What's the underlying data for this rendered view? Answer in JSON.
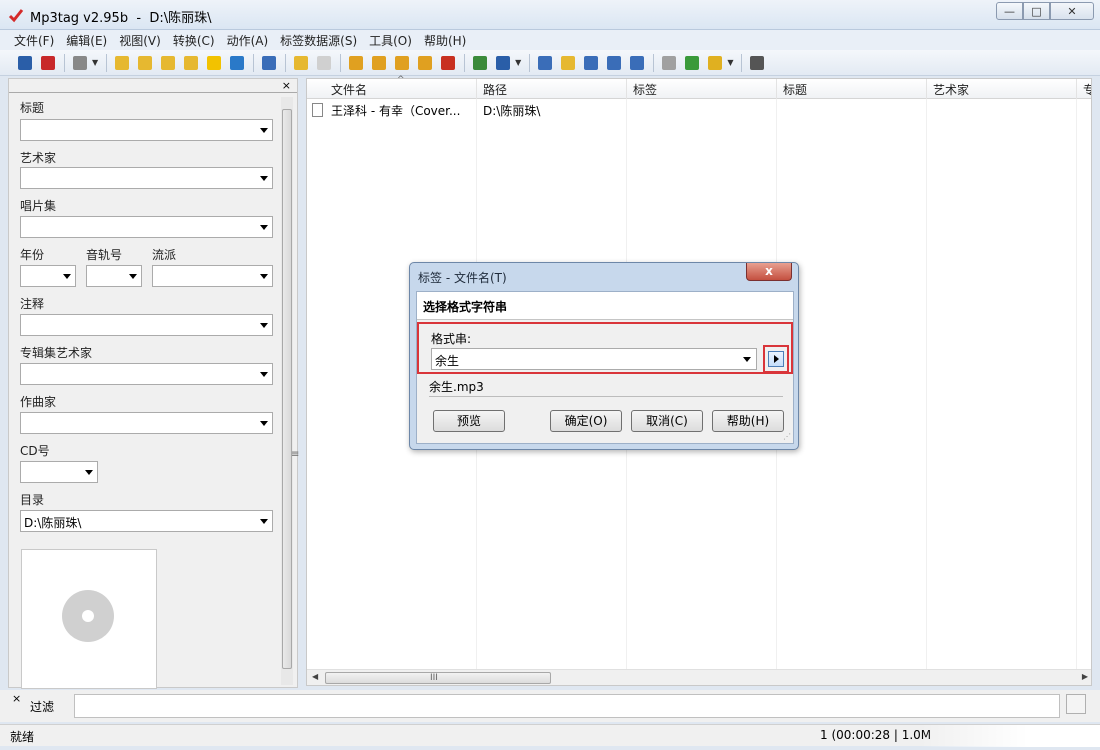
{
  "window": {
    "title": "Mp3tag v2.95b",
    "path": "D:\\陈丽珠\\",
    "minimize": "—",
    "maximize": "□",
    "close": "✕"
  },
  "menu": [
    "文件(F)",
    "编辑(E)",
    "视图(V)",
    "转换(C)",
    "动作(A)",
    "标签数据源(S)",
    "工具(O)",
    "帮助(H)"
  ],
  "toolbar": {
    "icons": [
      {
        "name": "save-icon",
        "color": "#2a5ea8"
      },
      {
        "name": "delete-icon",
        "color": "#c8282a"
      },
      {
        "name": "undo-icon",
        "color": "#888888"
      },
      {
        "name": "change-directory-icon",
        "color": "#e6b830"
      },
      {
        "name": "add-directory-icon",
        "color": "#e6b830"
      },
      {
        "name": "refresh-icon",
        "color": "#e6b830"
      },
      {
        "name": "open-folder-icon",
        "color": "#e6b830"
      },
      {
        "name": "favorites-icon",
        "color": "#f2c200"
      },
      {
        "name": "reload-icon",
        "color": "#2a79c8"
      },
      {
        "name": "list-icon",
        "color": "#3a6db8"
      },
      {
        "name": "copy-icon",
        "color": "#e6b830"
      },
      {
        "name": "paste-icon",
        "color": "#d0d0d0"
      },
      {
        "name": "tag-filename-icon",
        "color": "#e0a020"
      },
      {
        "name": "filename-tag-icon",
        "color": "#e0a020"
      },
      {
        "name": "filename-filename-icon",
        "color": "#e0a020"
      },
      {
        "name": "text-tag-icon",
        "color": "#e0a020"
      },
      {
        "name": "tag-tag-icon",
        "color": "#c83020"
      },
      {
        "name": "autonumber-icon",
        "color": "#3a8a3a"
      },
      {
        "name": "case-convert-icon",
        "color": "#2a5ea8"
      },
      {
        "name": "edit-icon",
        "color": "#3a6db8"
      },
      {
        "name": "export-icon",
        "color": "#e6b830"
      },
      {
        "name": "playlist-icon",
        "color": "#3a6db8"
      },
      {
        "name": "import-icon",
        "color": "#3a6db8"
      },
      {
        "name": "number-icon",
        "color": "#3a6db8"
      },
      {
        "name": "discogs-icon",
        "color": "#a0a0a0"
      },
      {
        "name": "freedb-icon",
        "color": "#3a9a3a"
      },
      {
        "name": "musicbrainz-icon",
        "color": "#e0b020"
      },
      {
        "name": "options-icon",
        "color": "#555555"
      }
    ]
  },
  "tag_panel": {
    "close": "×",
    "title_label": "标题",
    "artist_label": "艺术家",
    "album_label": "唱片集",
    "year_label": "年份",
    "track_label": "音轨号",
    "genre_label": "流派",
    "comment_label": "注释",
    "album_artist_label": "专辑集艺术家",
    "composer_label": "作曲家",
    "cd_label": "CD号",
    "directory_label": "目录",
    "directory_value": "D:\\陈丽珠\\",
    "grip": "≡"
  },
  "file_list": {
    "columns": [
      "文件名",
      "路径",
      "标签",
      "标题",
      "艺术家",
      "专"
    ],
    "rows": [
      {
        "filename": "王泽科 - 有幸（Cover...",
        "path": "D:\\陈丽珠\\"
      }
    ],
    "sort_indicator": "^",
    "scroll_grip": "III",
    "scroll_left": "◀",
    "scroll_right": "▶"
  },
  "filter": {
    "close": "×",
    "label": "过滤",
    "value": ""
  },
  "status": {
    "left": "就绪",
    "right": "1 (00:00:28 | 1.0M"
  },
  "dialog": {
    "title": "标签 - 文件名(T)",
    "close": "x",
    "heading": "选择格式字符串",
    "format_label": "格式串:",
    "format_value": "余生",
    "preview_value": "余生.mp3",
    "buttons": {
      "preview": "预览",
      "ok": "确定(O)",
      "cancel": "取消(C)",
      "help": "帮助(H)"
    },
    "highlight_color": "#d9353a",
    "resize": "⋰"
  }
}
